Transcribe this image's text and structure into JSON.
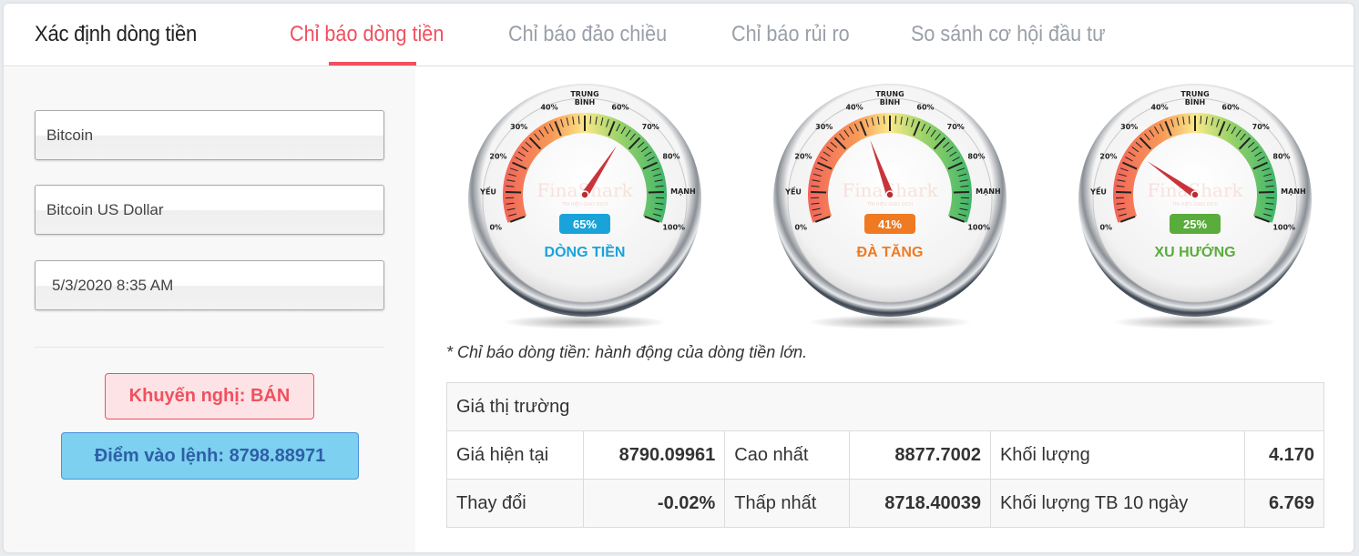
{
  "header": {
    "title": "Xác định dòng tiền",
    "tabs": [
      {
        "label": "Chỉ báo dòng tiền",
        "active": true
      },
      {
        "label": "Chỉ báo đảo chiều",
        "active": false
      },
      {
        "label": "Chỉ báo rủi ro",
        "active": false
      },
      {
        "label": "So sánh cơ hội đầu tư",
        "active": false
      }
    ]
  },
  "sidebar": {
    "asset_class": "Bitcoin",
    "symbol": "Bitcoin US Dollar",
    "datetime": "5/3/2020 8:35 AM",
    "recommendation": "Khuyến nghị: BÁN",
    "entry_point": "Điểm vào lệnh: 8798.88971"
  },
  "gauges": {
    "scale_labels": {
      "p0": "0%",
      "p20": "20%",
      "p30": "30%",
      "p40": "40%",
      "mid1": "TRUNG",
      "mid2": "BÌNH",
      "p60": "60%",
      "p70": "70%",
      "p80": "80%",
      "p100": "100%",
      "weak": "YẾU",
      "strong": "MẠNH"
    },
    "watermark": "FinaShark",
    "watermark_sub": "TÍN HIỆU GIAO DỊCH",
    "items": [
      {
        "name": "DÒNG TIỀN",
        "value": 65,
        "value_label": "65%",
        "color": "#1aa3d9"
      },
      {
        "name": "ĐÀ TĂNG",
        "value": 41,
        "value_label": "41%",
        "color": "#ef7a22"
      },
      {
        "name": "XU HƯỚNG",
        "value": 25,
        "value_label": "25%",
        "color": "#5aac3c"
      }
    ]
  },
  "note": "* Chỉ báo dòng tiền: hành động của dòng tiền lớn.",
  "market": {
    "title": "Giá thị trường",
    "rows": [
      [
        {
          "label": "Giá hiện tại",
          "value": "8790.09961"
        },
        {
          "label": "Cao nhất",
          "value": "8877.7002"
        },
        {
          "label": "Khối lượng",
          "value": "4.170"
        }
      ],
      [
        {
          "label": "Thay đổi",
          "value": "-0.02%"
        },
        {
          "label": "Thấp nhất",
          "value": "8718.40039"
        },
        {
          "label": "Khối lượng TB 10 ngày",
          "value": "6.769"
        }
      ]
    ]
  }
}
